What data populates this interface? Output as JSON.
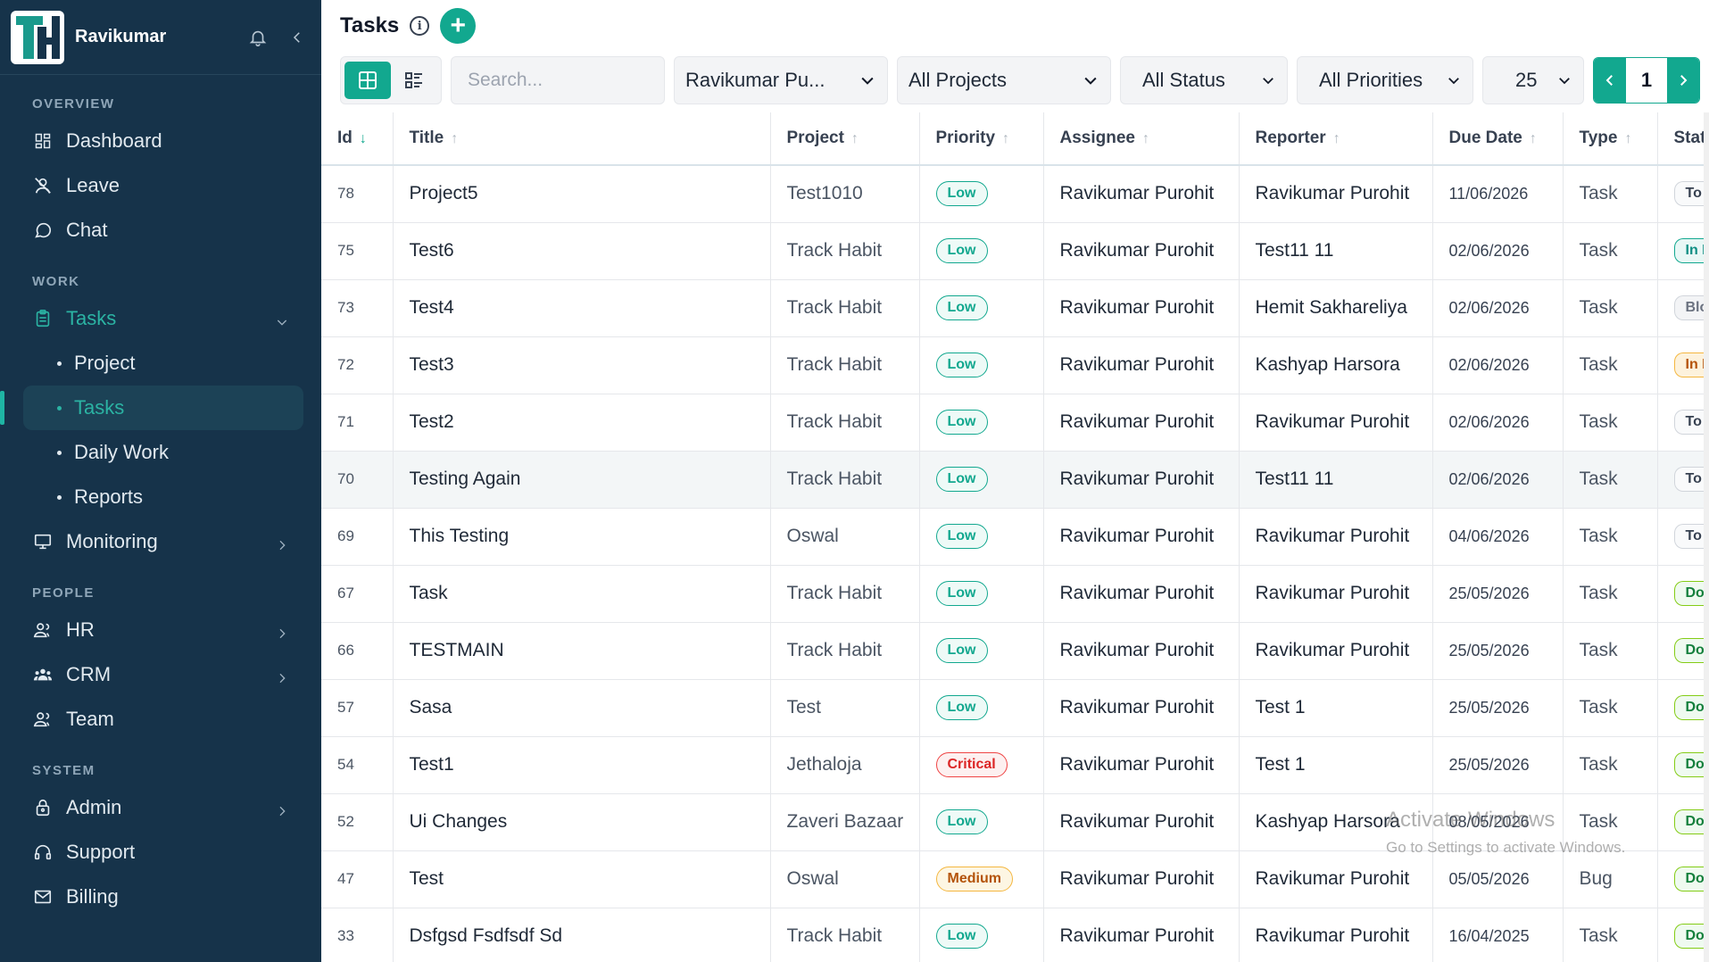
{
  "user": {
    "name": "Ravikumar"
  },
  "sidebar": {
    "sections": {
      "overview": "OVERVIEW",
      "work": "WORK",
      "people": "PEOPLE",
      "system": "SYSTEM"
    },
    "items": {
      "dashboard": "Dashboard",
      "leave": "Leave",
      "chat": "Chat",
      "tasks": "Tasks",
      "project": "Project",
      "tasks_sub": "Tasks",
      "daily_work": "Daily Work",
      "reports": "Reports",
      "monitoring": "Monitoring",
      "hr": "HR",
      "crm": "CRM",
      "team": "Team",
      "admin": "Admin",
      "support": "Support",
      "billing": "Billing"
    }
  },
  "header": {
    "title": "Tasks",
    "info": "i",
    "add": "+"
  },
  "filters": {
    "search_placeholder": "Search...",
    "assignee": "Ravikumar Pu...",
    "project": "All Projects",
    "status": "All Status",
    "priority": "All Priorities",
    "page_size": "25",
    "page": "1"
  },
  "table": {
    "columns": {
      "id": "Id",
      "title": "Title",
      "project": "Project",
      "priority": "Priority",
      "assignee": "Assignee",
      "reporter": "Reporter",
      "due_date": "Due Date",
      "type": "Type",
      "status": "Statu"
    },
    "rows": [
      {
        "id": "78",
        "title": "Project5",
        "project": "Test1010",
        "priority": "Low",
        "assignee": "Ravikumar Purohit",
        "reporter": "Ravikumar Purohit",
        "due": "11/06/2026",
        "type": "Task",
        "status": "To I"
      },
      {
        "id": "75",
        "title": "Test6",
        "project": "Track Habit",
        "priority": "Low",
        "assignee": "Ravikumar Purohit",
        "reporter": "Test11 11",
        "due": "02/06/2026",
        "type": "Task",
        "status": "In F"
      },
      {
        "id": "73",
        "title": "Test4",
        "project": "Track Habit",
        "priority": "Low",
        "assignee": "Ravikumar Purohit",
        "reporter": "Hemit Sakhareliya",
        "due": "02/06/2026",
        "type": "Task",
        "status": "Blo"
      },
      {
        "id": "72",
        "title": "Test3",
        "project": "Track Habit",
        "priority": "Low",
        "assignee": "Ravikumar Purohit",
        "reporter": "Kashyap Harsora",
        "due": "02/06/2026",
        "type": "Task",
        "status": "In F"
      },
      {
        "id": "71",
        "title": "Test2",
        "project": "Track Habit",
        "priority": "Low",
        "assignee": "Ravikumar Purohit",
        "reporter": "Ravikumar Purohit",
        "due": "02/06/2026",
        "type": "Task",
        "status": "To I"
      },
      {
        "id": "70",
        "title": "Testing Again",
        "project": "Track Habit",
        "priority": "Low",
        "assignee": "Ravikumar Purohit",
        "reporter": "Test11 11",
        "due": "02/06/2026",
        "type": "Task",
        "status": "To I"
      },
      {
        "id": "69",
        "title": "This Testing",
        "project": "Oswal",
        "priority": "Low",
        "assignee": "Ravikumar Purohit",
        "reporter": "Ravikumar Purohit",
        "due": "04/06/2026",
        "type": "Task",
        "status": "To I"
      },
      {
        "id": "67",
        "title": "Task",
        "project": "Track Habit",
        "priority": "Low",
        "assignee": "Ravikumar Purohit",
        "reporter": "Ravikumar Purohit",
        "due": "25/05/2026",
        "type": "Task",
        "status": "Dor"
      },
      {
        "id": "66",
        "title": "TESTMAIN",
        "project": "Track Habit",
        "priority": "Low",
        "assignee": "Ravikumar Purohit",
        "reporter": "Ravikumar Purohit",
        "due": "25/05/2026",
        "type": "Task",
        "status": "Dor"
      },
      {
        "id": "57",
        "title": "Sasa",
        "project": "Test",
        "priority": "Low",
        "assignee": "Ravikumar Purohit",
        "reporter": "Test 1",
        "due": "25/05/2026",
        "type": "Task",
        "status": "Dor"
      },
      {
        "id": "54",
        "title": "Test1",
        "project": "Jethaloja",
        "priority": "Critical",
        "assignee": "Ravikumar Purohit",
        "reporter": "Test 1",
        "due": "25/05/2026",
        "type": "Task",
        "status": "Dor"
      },
      {
        "id": "52",
        "title": "Ui Changes",
        "project": "Zaveri Bazaar",
        "priority": "Low",
        "assignee": "Ravikumar Purohit",
        "reporter": "Kashyap Harsora",
        "due": "08/05/2026",
        "type": "Task",
        "status": "Dor"
      },
      {
        "id": "47",
        "title": "Test",
        "project": "Oswal",
        "priority": "Medium",
        "assignee": "Ravikumar Purohit",
        "reporter": "Ravikumar Purohit",
        "due": "05/05/2026",
        "type": "Bug",
        "status": "Dor"
      },
      {
        "id": "33",
        "title": "Dsfgsd Fsdfsdf Sd",
        "project": "Track Habit",
        "priority": "Low",
        "assignee": "Ravikumar Purohit",
        "reporter": "Ravikumar Purohit",
        "due": "16/04/2025",
        "type": "Task",
        "status": "Dor"
      }
    ]
  },
  "watermark": {
    "line1": "Activate Windows",
    "line2": "Go to Settings to activate Windows."
  },
  "colors": {
    "sidebar_bg": "#16334a",
    "accent": "#12a88f",
    "critical": "#dc2626",
    "medium": "#b45309"
  }
}
